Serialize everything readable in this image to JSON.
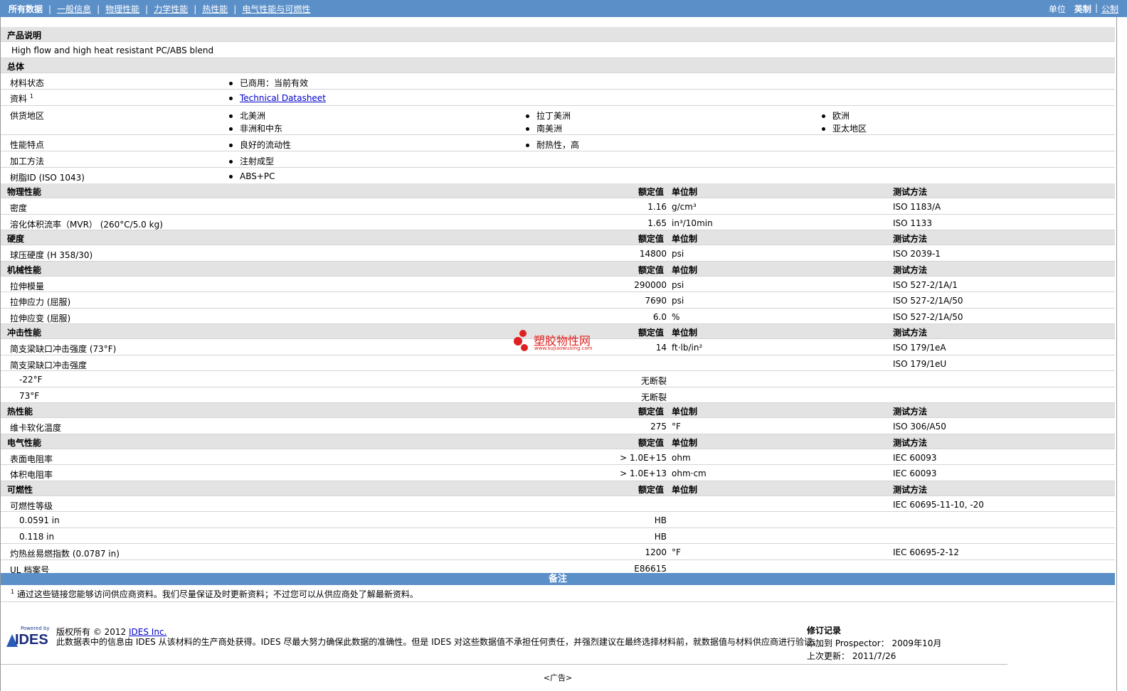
{
  "nav": {
    "items": [
      "所有数据",
      "一般信息",
      "物理性能",
      "力学性能",
      "热性能",
      "电气性能与可燃性"
    ],
    "units_label": "单位",
    "units": [
      "英制",
      "公制"
    ]
  },
  "product": {
    "section": "产品说明",
    "description": "High flow and high heat resistant PC/ABS blend"
  },
  "general": {
    "section": "总体",
    "rows": [
      {
        "label": "材料状态",
        "items": [
          "已商用：当前有效"
        ]
      },
      {
        "label": "资料",
        "sup": "1",
        "items": [
          "Technical Datasheet"
        ]
      },
      {
        "label": "供货地区",
        "items": [
          "北美洲",
          "拉丁美洲",
          "欧洲",
          "非洲和中东",
          "南美洲",
          "亚太地区"
        ]
      },
      {
        "label": "性能特点",
        "items": [
          "良好的流动性",
          "耐热性，高"
        ]
      },
      {
        "label": "加工方法",
        "items": [
          "注射成型"
        ]
      },
      {
        "label": "树脂ID (ISO 1043)",
        "items": [
          "ABS+PC"
        ]
      }
    ]
  },
  "headers": {
    "value": "额定值",
    "unit": "单位制",
    "test": "测试方法"
  },
  "sections": [
    {
      "title": "物理性能",
      "rows": [
        {
          "label": "密度",
          "value": "1.16",
          "unit": "g/cm³",
          "test": "ISO 1183/A"
        },
        {
          "label": "溶化体积流率（MVR） (260°C/5.0 kg)",
          "value": "1.65",
          "unit": "in³/10min",
          "test": "ISO 1133"
        }
      ]
    },
    {
      "title": "硬度",
      "rows": [
        {
          "label": "球压硬度 (H 358/30)",
          "value": "14800",
          "unit": "psi",
          "test": "ISO 2039-1"
        }
      ]
    },
    {
      "title": "机械性能",
      "rows": [
        {
          "label": "拉伸模量",
          "value": "290000",
          "unit": "psi",
          "test": "ISO 527-2/1A/1"
        },
        {
          "label": "拉伸应力 (屈服)",
          "value": "7690",
          "unit": "psi",
          "test": "ISO 527-2/1A/50"
        },
        {
          "label": "拉伸应变 (屈服)",
          "value": "6.0",
          "unit": "%",
          "test": "ISO 527-2/1A/50"
        }
      ]
    },
    {
      "title": "冲击性能",
      "rows": [
        {
          "label": "简支梁缺口冲击强度 (73°F)",
          "value": "14",
          "unit": "ft·lb/in²",
          "test": "ISO 179/1eA"
        },
        {
          "label": "简支梁缺口冲击强度",
          "value": "",
          "unit": "",
          "test": "ISO 179/1eU"
        },
        {
          "label": "-22°F",
          "sub": true,
          "value": "无断裂",
          "unit": "",
          "test": ""
        },
        {
          "label": "73°F",
          "sub": true,
          "value": "无断裂",
          "unit": "",
          "test": ""
        }
      ]
    },
    {
      "title": "热性能",
      "rows": [
        {
          "label": "维卡软化温度",
          "value": "275",
          "unit": "°F",
          "test": "ISO 306/A50"
        }
      ]
    },
    {
      "title": "电气性能",
      "rows": [
        {
          "label": "表面电阻率",
          "value": "> 1.0E+15",
          "unit": "ohm",
          "test": "IEC 60093"
        },
        {
          "label": "体积电阻率",
          "value": "> 1.0E+13",
          "unit": "ohm·cm",
          "test": "IEC 60093"
        }
      ]
    },
    {
      "title": "可燃性",
      "rows": [
        {
          "label": "可燃性等级",
          "value": "",
          "unit": "",
          "test": "IEC 60695-11-10, -20"
        },
        {
          "label": "0.0591 in",
          "sub": true,
          "value": "HB",
          "unit": "",
          "test": ""
        },
        {
          "label": "0.118 in",
          "sub": true,
          "value": "HB",
          "unit": "",
          "test": ""
        },
        {
          "label": "灼热丝易燃指数 (0.0787 in)",
          "value": "1200",
          "unit": "°F",
          "test": "IEC 60695-2-12"
        },
        {
          "label": "UL 档案号",
          "value": "E86615",
          "unit": "",
          "test": ""
        }
      ]
    }
  ],
  "notes": {
    "title": "备注",
    "sup": "1",
    "text": "通过这些链接您能够访问供应商资料。我们尽量保证及时更新资料；不过您可以从供应商处了解最新资料。"
  },
  "footer": {
    "powered_by": "Powered by",
    "logo_text": "IDES",
    "copyright_prefix": "版权所有 © 2012",
    "copyright_link": "IDES Inc.",
    "disclaimer": "此数据表中的信息由 IDES 从该材料的生产商处获得。IDES 尽最大努力确保此数据的准确性。但是 IDES 对这些数据值不承担任何责任，并强烈建议在最终选择材料前，就数据值与材料供应商进行验证。",
    "revision_title": "修订记录",
    "added_label": "添加到 Prospector：",
    "added_value": "2009年10月",
    "updated_label": "上次更新：",
    "updated_value": "2011/7/26",
    "ad": "<广告>"
  },
  "watermark": {
    "cn": "塑胶物性网",
    "en": "www.sujiaowuxing.com"
  }
}
